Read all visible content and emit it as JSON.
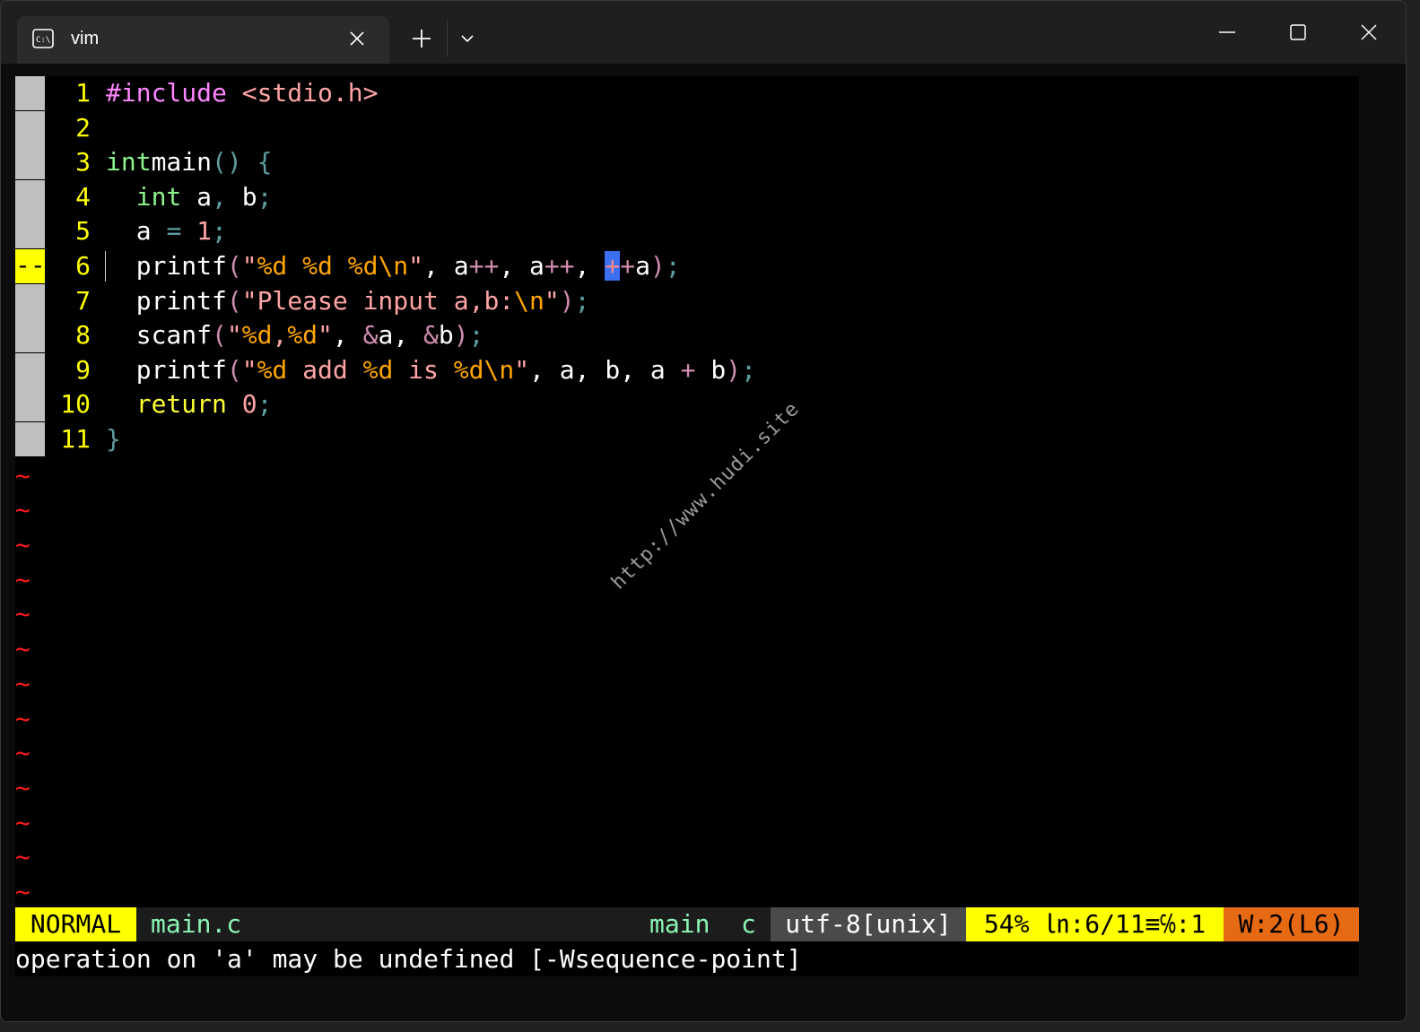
{
  "tab": {
    "title": "vim"
  },
  "icons": {
    "tab": "terminal-icon",
    "close_tab": "close-icon",
    "new_tab": "plus-icon",
    "dropdown": "chevron-down-icon",
    "minimize": "minimize-icon",
    "maximize": "maximize-icon",
    "close_window": "close-icon"
  },
  "colors": {
    "line_numbers": "#ffff00",
    "tilde": "#ff1a1a",
    "sign_column": "#c0c0c0",
    "warning_sign": "#ffff00",
    "cursor": "#3b6ff0",
    "status_mode_bg": "#ffff00",
    "status_warn_bg": "#e66914"
  },
  "editor": {
    "lines": [
      {
        "num": "1",
        "tokens": [
          [
            "pp",
            "#include "
          ],
          [
            "str",
            "<stdio.h>"
          ]
        ]
      },
      {
        "num": "2",
        "tokens": []
      },
      {
        "num": "3",
        "tokens": [
          [
            "kw",
            "int"
          ],
          [
            "",
            "main"
          ],
          [
            "pun",
            "()"
          ],
          [
            "pun",
            " {"
          ]
        ]
      },
      {
        "num": "4",
        "tokens": [
          [
            "",
            "  "
          ],
          [
            "kw",
            "int"
          ],
          [
            "",
            " a"
          ],
          [
            "pun",
            ","
          ],
          [
            "",
            " b"
          ],
          [
            "pun",
            ";"
          ]
        ]
      },
      {
        "num": "5",
        "tokens": [
          [
            "",
            "  a "
          ],
          [
            "pun",
            "="
          ],
          [
            "num",
            " 1"
          ],
          [
            "pun",
            ";"
          ]
        ]
      },
      {
        "num": "6",
        "sign": "--",
        "tokens": [
          [
            "",
            "  printf"
          ],
          [
            "op",
            "("
          ],
          [
            "str",
            "\""
          ],
          [
            "fmt",
            "%d"
          ],
          [
            "str",
            " "
          ],
          [
            "fmt",
            "%d"
          ],
          [
            "str",
            " "
          ],
          [
            "fmt",
            "%d"
          ],
          [
            "fmt",
            "\\n"
          ],
          [
            "str",
            "\""
          ],
          [
            "",
            ", a"
          ],
          [
            "op",
            "++"
          ],
          [
            "",
            ", a"
          ],
          [
            "op",
            "++"
          ],
          [
            "",
            ", "
          ],
          [
            "cur",
            "+"
          ],
          [
            "op",
            "+"
          ],
          [
            "",
            "a"
          ],
          [
            "op",
            ")"
          ],
          [
            "pun",
            ";"
          ]
        ]
      },
      {
        "num": "7",
        "tokens": [
          [
            "",
            "  printf"
          ],
          [
            "op",
            "("
          ],
          [
            "str",
            "\"Please input a,b:"
          ],
          [
            "fmt",
            "\\n"
          ],
          [
            "str",
            "\""
          ],
          [
            "op",
            ")"
          ],
          [
            "pun",
            ";"
          ]
        ]
      },
      {
        "num": "8",
        "tokens": [
          [
            "",
            "  scanf"
          ],
          [
            "op",
            "("
          ],
          [
            "str",
            "\""
          ],
          [
            "fmt",
            "%d"
          ],
          [
            "str",
            ","
          ],
          [
            "fmt",
            "%d"
          ],
          [
            "str",
            "\""
          ],
          [
            "",
            ", "
          ],
          [
            "op",
            "&"
          ],
          [
            "",
            "a, "
          ],
          [
            "op",
            "&"
          ],
          [
            "",
            "b"
          ],
          [
            "op",
            ")"
          ],
          [
            "pun",
            ";"
          ]
        ]
      },
      {
        "num": "9",
        "tokens": [
          [
            "",
            "  printf"
          ],
          [
            "op",
            "("
          ],
          [
            "str",
            "\""
          ],
          [
            "fmt",
            "%d"
          ],
          [
            "str",
            " add "
          ],
          [
            "fmt",
            "%d"
          ],
          [
            "str",
            " is "
          ],
          [
            "fmt",
            "%d"
          ],
          [
            "fmt",
            "\\n"
          ],
          [
            "str",
            "\""
          ],
          [
            "",
            ", a, b, a "
          ],
          [
            "op",
            "+"
          ],
          [
            "",
            " b"
          ],
          [
            "op",
            ")"
          ],
          [
            "pun",
            ";"
          ]
        ]
      },
      {
        "num": "10",
        "tokens": [
          [
            "",
            "  "
          ],
          [
            "yel",
            "return"
          ],
          [
            "num",
            " 0"
          ],
          [
            "pun",
            ";"
          ]
        ]
      },
      {
        "num": "11",
        "tokens": [
          [
            "pun",
            "}"
          ]
        ]
      }
    ],
    "tilde_char": "~",
    "tilde_count": 13
  },
  "statusline": {
    "mode": "NORMAL",
    "file": "main.c",
    "function": "main",
    "filetype": "c",
    "encoding": "utf-8[unix]",
    "position": "54% ㏑:6/11≡℅:1",
    "warnings": "W:2(L6)"
  },
  "cmdline": "operation on 'a' may be undefined [-Wsequence-point]",
  "watermark": "http://www.hudi.site"
}
